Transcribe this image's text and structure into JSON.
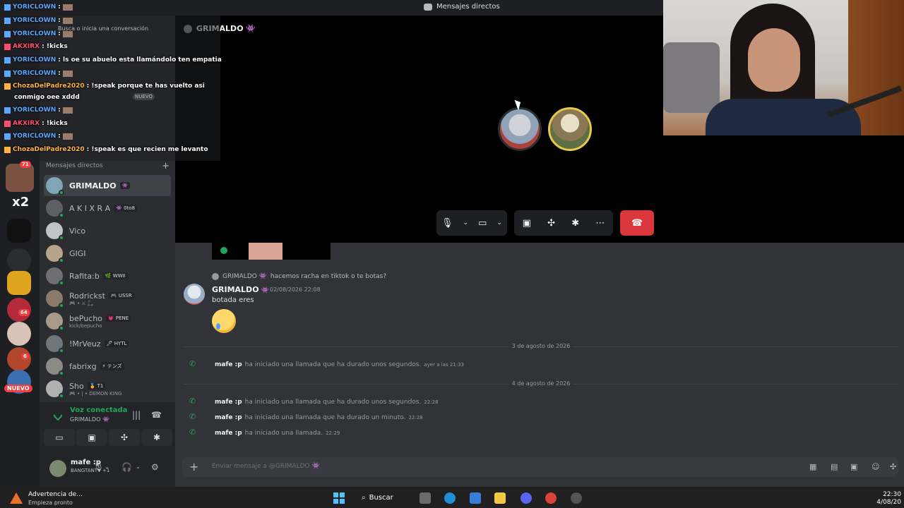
{
  "titlebar": {
    "title": "Mensajes directos"
  },
  "overlay": {
    "hint": "Busca o inicia una conversación",
    "lines": [
      {
        "user": "YORICLOWN",
        "text": ":",
        "color": "#5fa8ff"
      },
      {
        "user": "YORICLOWN",
        "text": ":",
        "color": "#5fa8ff"
      },
      {
        "user": "YORICLOWN",
        "text": ":",
        "color": "#5fa8ff"
      },
      {
        "user": "AKXIRX",
        "text": ": !kicks",
        "color": "#ff4d6d"
      },
      {
        "user": "YORICLOWN",
        "text": ": ls oe su abuelo esta llamándolo ten empatia",
        "color": "#5fa8ff"
      },
      {
        "user": "YORICLOWN",
        "text": ":",
        "color": "#5fa8ff"
      },
      {
        "user": "ChozaDelPadre2020",
        "text": ": !speak porque te has vuelto asi",
        "color": "#ffb340"
      },
      {
        "user": "",
        "text": "conmigo oee xddd",
        "color": "#ffffff"
      },
      {
        "user": "YORICLOWN",
        "text": ":",
        "color": "#5fa8ff"
      },
      {
        "user": "AKXIRX",
        "text": ": !kicks",
        "color": "#ff4d6d"
      },
      {
        "user": "YORICLOWN",
        "text": ":",
        "color": "#5fa8ff"
      },
      {
        "user": "ChozaDelPadre2020",
        "text": ": !speak es que recien me levanto",
        "color": "#ffb340"
      }
    ],
    "nuevo": "NUEVO"
  },
  "rail": {
    "badge_top": "71",
    "badge_mid": "64",
    "badge_mid2": "6",
    "nuevo": "NUEVO",
    "x2": "x2"
  },
  "sidebar": {
    "header": "Mensajes directos",
    "dms": [
      {
        "name": "GRIMALDO",
        "tag": "👾",
        "sub": "",
        "color": "#7fa6b5",
        "active": true
      },
      {
        "name": "A K I X R A",
        "tag": "👾 0to8",
        "sub": "",
        "color": "#5f5f66",
        "active": false
      },
      {
        "name": "Vico",
        "tag": "",
        "sub": "",
        "color": "#c0c4c8",
        "active": false
      },
      {
        "name": "GIGI",
        "tag": "",
        "sub": "",
        "color": "#b8a48c",
        "active": false
      },
      {
        "name": "Rafita:b",
        "tag": "🌿 WWII",
        "sub": "",
        "color": "#6e6e74",
        "active": false
      },
      {
        "name": "Rodrickst",
        "tag": "🎮 USSR",
        "sub": "🎮 • ⚔ 🛴",
        "color": "#8a7a6a",
        "active": false
      },
      {
        "name": "bePucho",
        "tag": "💗 PENE",
        "sub": "kick/bepucho",
        "color": "#a89a88",
        "active": false
      },
      {
        "name": "!MrVeuz",
        "tag": "🖊 HYTL",
        "sub": "",
        "color": "#70767c",
        "active": false
      },
      {
        "name": "fabrixg",
        "tag": "⚡ テンズ",
        "sub": "",
        "color": "#8c8a84",
        "active": false
      },
      {
        "name": "Sho",
        "tag": "🏅 T1",
        "sub": "🎮 • | • DEMON KING",
        "color": "#b0b0b0",
        "active": false
      }
    ]
  },
  "voice": {
    "title": "Voz conectada",
    "sub": "GRIMALDO 👾"
  },
  "user": {
    "name": "mafe :p",
    "status": "BANGTANTV +1"
  },
  "call": {
    "header": "GRIMALDO 👾"
  },
  "chat": {
    "reply_author": "GRIMALDO 👾",
    "reply_text": "hacemos racha en tiktok o te botas?",
    "author": "GRIMALDO",
    "author_badge": "👾",
    "timestamp": "02/08/2026 22:08",
    "body": "botada eres",
    "dividers": [
      "3 de agosto de 2026",
      "4 de agosto de 2026"
    ],
    "system": [
      {
        "who": "mafe :p",
        "text": "ha iniciado una llamada que ha durado unos segundos.",
        "time": "ayer a las 21:33"
      },
      {
        "who": "mafe :p",
        "text": "ha iniciado una llamada que ha durado unos segundos.",
        "time": "22:28"
      },
      {
        "who": "mafe :p",
        "text": "ha iniciado una llamada que ha durado un minuto.",
        "time": "22:28"
      },
      {
        "who": "mafe :p",
        "text": "ha iniciado una llamada.",
        "time": "22:29"
      }
    ],
    "placeholder": "Enviar mensaje a @GRIMALDO 👾"
  },
  "taskbar": {
    "warning_title": "Advertencia de...",
    "warning_sub": "Empieza pronto",
    "search": "Buscar",
    "time": "22:30",
    "date": "4/08/20"
  }
}
